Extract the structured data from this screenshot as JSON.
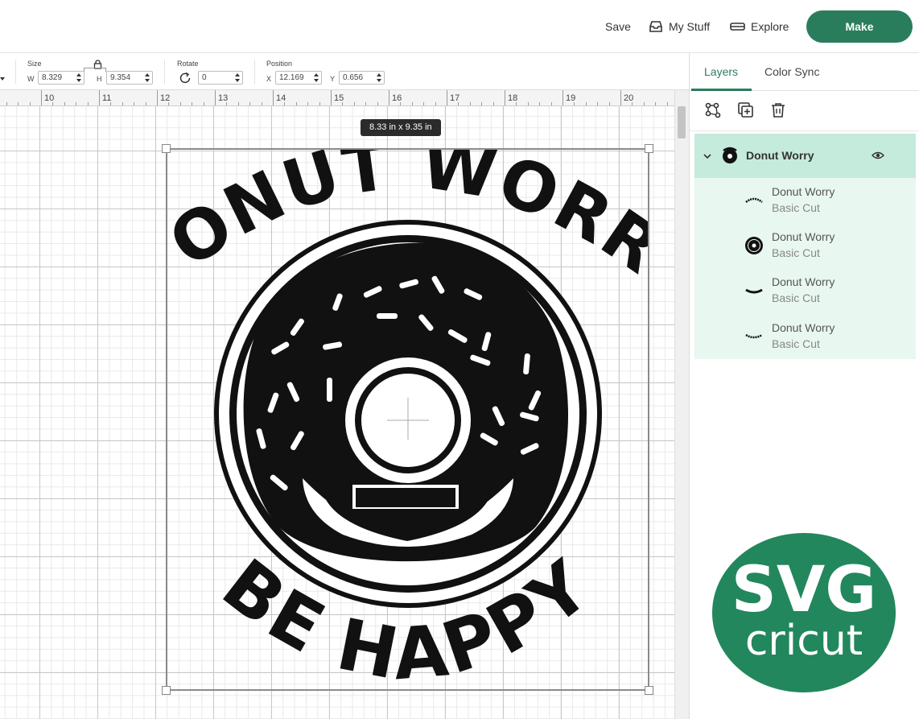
{
  "topbar": {
    "save_label": "Save",
    "my_stuff_label": "My Stuff",
    "explore_label": "Explore",
    "make_label": "Make"
  },
  "edit_toolbar": {
    "size_label": "Size",
    "width_letter": "W",
    "width_value": "8.329",
    "height_letter": "H",
    "height_value": "9.354",
    "rotate_label": "Rotate",
    "rotate_value": "0",
    "position_label": "Position",
    "x_letter": "X",
    "x_value": "12.169",
    "y_letter": "Y",
    "y_value": "0.656"
  },
  "ruler": {
    "numbers": [
      "10",
      "11",
      "12",
      "13",
      "14",
      "15",
      "16",
      "17",
      "18",
      "19",
      "20"
    ]
  },
  "canvas": {
    "dimension_tooltip": "8.33  in x 9.35  in",
    "design_text_top": "DONUT WORRY",
    "design_text_bottom": "BE HAPPY"
  },
  "panel": {
    "tab_layers": "Layers",
    "tab_color_sync": "Color Sync",
    "group": {
      "name": "Donut Worry",
      "icons": [
        "chevron-down-icon",
        "eye-icon"
      ]
    },
    "layers": [
      {
        "name": "Donut Worry",
        "operation": "Basic Cut",
        "thumb": "arc-text-thumb"
      },
      {
        "name": "Donut Worry",
        "operation": "Basic Cut",
        "thumb": "donut-thumb"
      },
      {
        "name": "Donut Worry",
        "operation": "Basic Cut",
        "thumb": "smile-thumb"
      },
      {
        "name": "Donut Worry",
        "operation": "Basic Cut",
        "thumb": "be-happy-thumb"
      }
    ]
  },
  "badge": {
    "line1": "SVG",
    "line2": "cricut",
    "color": "#22875c"
  },
  "colors": {
    "accent": "#2a7d5c",
    "layer_selected": "#c5ebdc",
    "layer_list": "#e8f7f0"
  }
}
